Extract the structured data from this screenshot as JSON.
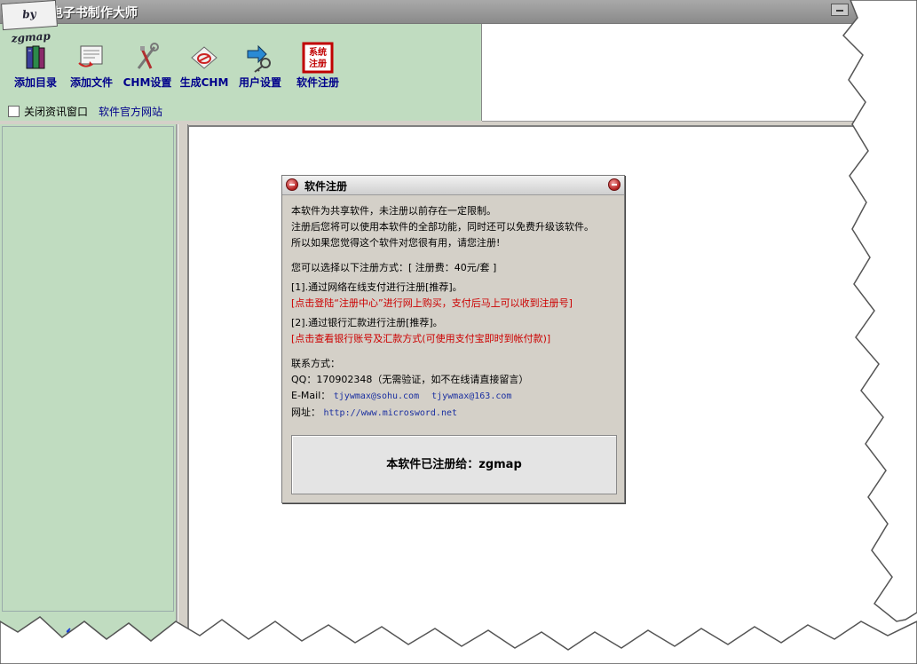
{
  "window": {
    "logo_text": "by zgmap",
    "title": "CHM电子书制作大师"
  },
  "toolbar": {
    "buttons": [
      {
        "label": "添加目录",
        "icon": "books-icon"
      },
      {
        "label": "添加文件",
        "icon": "add-file-icon"
      },
      {
        "label": "CHM设置",
        "icon": "tools-icon"
      },
      {
        "label": "生成CHM",
        "icon": "build-chm-icon"
      },
      {
        "label": "用户设置",
        "icon": "user-key-icon"
      },
      {
        "label": "软件注册",
        "icon": "register-stamp-icon"
      }
    ],
    "register_stamp": "系统注册",
    "close_news_checkbox_label": "关闭资讯窗口",
    "official_site_link": "软件官方网站"
  },
  "left_panel": {
    "arrows": [
      "↓",
      "←"
    ]
  },
  "dialog": {
    "title": "软件注册",
    "intro": [
      "本软件为共享软件，未注册以前存在一定限制。",
      "注册后您将可以使用本软件的全部功能，同时还可以免费升级该软件。",
      "所以如果您觉得这个软件对您很有用，请您注册!"
    ],
    "methods_heading": "您可以选择以下注册方式：[ 注册费：40元/套 ]",
    "method1": "[1].通过网络在线支付进行注册[推荐]。",
    "method1_link": "[点击登陆“注册中心”进行网上购买，支付后马上可以收到注册号]",
    "method2": "[2].通过银行汇款进行注册[推荐]。",
    "method2_link": "[点击查看银行账号及汇款方式(可使用支付宝即时到帐付款)]",
    "contact_heading": "联系方式：",
    "qq_label": "QQ：",
    "qq_value": "170902348（无需验证，如不在线请直接留言）",
    "email_label": "E-Mail：",
    "email1": "tjywmax@sohu.com",
    "email2": "tjywmax@163.com",
    "website_label": "网址：",
    "website": "http://www.microsword.net",
    "registered_to": "本软件已注册给：zgmap"
  },
  "colors": {
    "panel_green": "#c0dcc0",
    "label_blue": "#00008b",
    "warning_red": "#cc0000"
  }
}
